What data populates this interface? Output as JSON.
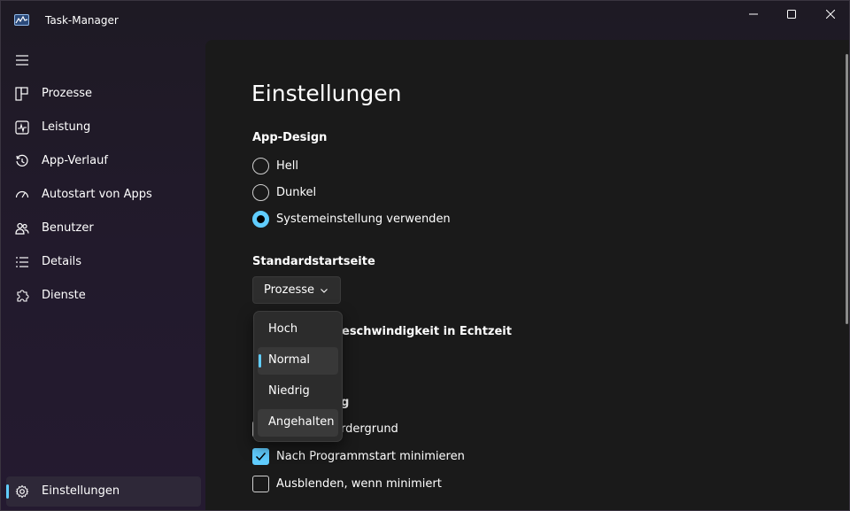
{
  "window": {
    "title": "Task-Manager",
    "accent_color": "#60cdff"
  },
  "sidebar": {
    "menu_icon": "hamburger-icon",
    "items": [
      {
        "label": "Prozesse",
        "icon": "processes-icon"
      },
      {
        "label": "Leistung",
        "icon": "performance-icon"
      },
      {
        "label": "App-Verlauf",
        "icon": "history-icon"
      },
      {
        "label": "Autostart von Apps",
        "icon": "speedometer-icon"
      },
      {
        "label": "Benutzer",
        "icon": "users-icon"
      },
      {
        "label": "Details",
        "icon": "list-icon"
      },
      {
        "label": "Dienste",
        "icon": "puzzle-icon"
      }
    ],
    "settings": {
      "label": "Einstellungen",
      "icon": "gear-icon",
      "active": true
    }
  },
  "main": {
    "title": "Einstellungen",
    "app_design": {
      "heading": "App-Design",
      "options": [
        {
          "label": "Hell",
          "checked": false
        },
        {
          "label": "Dunkel",
          "checked": false
        },
        {
          "label": "Systemeinstellung verwenden",
          "checked": true
        }
      ]
    },
    "start_page": {
      "heading": "Standardstartseite",
      "selected": "Prozesse"
    },
    "update_speed": {
      "heading_visible_part": "eschwindigkeit in Echtzeit",
      "options": [
        {
          "label": "Hoch"
        },
        {
          "label": "Normal",
          "selected": true
        },
        {
          "label": "Niedrig"
        },
        {
          "label": "Angehalten",
          "hover": true
        }
      ]
    },
    "window_mgmt": {
      "heading_visible_part": "g",
      "options": [
        {
          "label_visible_part": "rdergrund",
          "checked": false
        },
        {
          "label": "Nach Programmstart minimieren",
          "checked": true
        },
        {
          "label": "Ausblenden, wenn minimiert",
          "checked": false
        }
      ]
    }
  }
}
